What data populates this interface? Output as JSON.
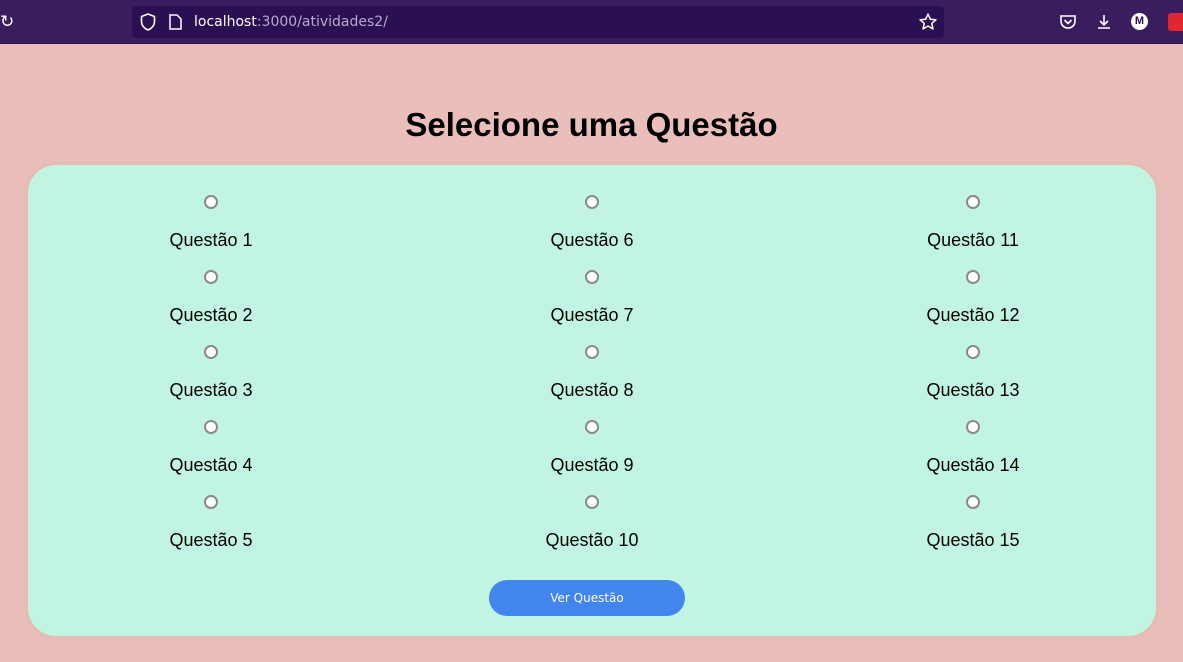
{
  "browser": {
    "url_host": "localhost",
    "url_rest": ":3000/atividades2/",
    "profile_initial": "M",
    "colors": {
      "toolbar": "#3A1D5E",
      "urlbar": "#2A0F52"
    }
  },
  "page": {
    "title": "Selecione uma Questão",
    "columns": [
      {
        "items": [
          {
            "label": "Questão 1"
          },
          {
            "label": "Questão 2"
          },
          {
            "label": "Questão 3"
          },
          {
            "label": "Questão 4"
          },
          {
            "label": "Questão 5"
          }
        ]
      },
      {
        "items": [
          {
            "label": "Questão 6"
          },
          {
            "label": "Questão 7"
          },
          {
            "label": "Questão 8"
          },
          {
            "label": "Questão 9"
          },
          {
            "label": "Questão 10"
          }
        ]
      },
      {
        "items": [
          {
            "label": "Questão 11"
          },
          {
            "label": "Questão 12"
          },
          {
            "label": "Questão 13"
          },
          {
            "label": "Questão 14"
          },
          {
            "label": "Questão 15"
          }
        ]
      }
    ],
    "button_label": "Ver Questão",
    "colors": {
      "background": "#EBBFB9",
      "card": "#C1F5E1",
      "button": "#4285EC"
    }
  }
}
